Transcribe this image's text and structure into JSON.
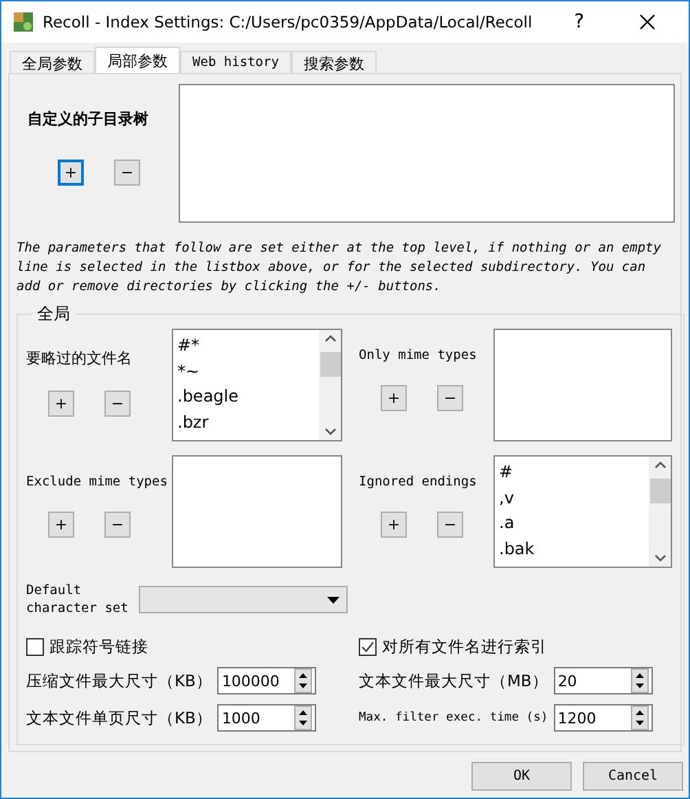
{
  "window": {
    "title": "Recoll - Index Settings: C:/Users/pc0359/AppData/Local/Recoll",
    "help": "?"
  },
  "tabs": [
    {
      "label": "全局参数",
      "selected": false
    },
    {
      "label": "局部参数",
      "selected": true
    },
    {
      "label": "Web history",
      "selected": false
    },
    {
      "label": "搜索参数",
      "selected": false
    }
  ],
  "subdirs": {
    "label": "自定义的子目录树",
    "add": "+",
    "remove": "−"
  },
  "note": "The parameters that follow are set either at the top level, if nothing or an empty line is selected in the listbox above, or for the selected subdirectory. You can add or remove directories by clicking the +/- buttons.",
  "group": {
    "title": "全局",
    "lists": [
      {
        "label": "要略过的文件名",
        "add": "+",
        "remove": "−",
        "items": [
          "#*",
          "*~",
          ".beagle",
          ".bzr"
        ],
        "scrollbar": true
      },
      {
        "label": "Only mime types",
        "add": "+",
        "remove": "−",
        "scrollbar": false
      },
      {
        "label": "Exclude mime types",
        "add": "+",
        "remove": "−",
        "scrollbar": false
      },
      {
        "label": "Ignored endings",
        "add": "+",
        "remove": "−",
        "items": [
          "#",
          ",v",
          ".a",
          ".bak"
        ],
        "scrollbar": true
      }
    ],
    "charset": {
      "label": "Default character set"
    },
    "checkboxes": [
      {
        "label": "跟踪符号链接",
        "checked": false
      },
      {
        "label": "对所有文件名进行索引",
        "checked": true
      }
    ],
    "spinners": [
      {
        "label": "压缩文件最大尺寸（KB）",
        "value": "100000"
      },
      {
        "label": "文本文件最大尺寸（MB）",
        "value": "20"
      },
      {
        "label": "文本文件单页尺寸（KB）",
        "value": "1000"
      },
      {
        "label": "Max. filter exec. time (s)",
        "value": "1200"
      }
    ]
  },
  "buttons": [
    "OK",
    "Cancel"
  ]
}
